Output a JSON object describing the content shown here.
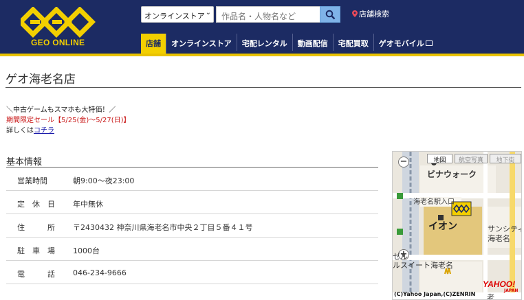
{
  "header": {
    "logo_text": "GEO ONLINE",
    "store_select": "オンラインストア",
    "search_placeholder": "作品名・人物名など",
    "store_search_label": "店舗検索"
  },
  "nav": {
    "items": [
      "店舗",
      "オンラインストア",
      "宅配レンタル",
      "動画配信",
      "宅配買取",
      "ゲオモバイル"
    ],
    "active_index": 0
  },
  "store": {
    "name": "ゲオ海老名店"
  },
  "promo": {
    "line1": "＼中古ゲームもスマホも大特価！／",
    "line2": "期間限定セール【5/25(金)～5/27(日)】",
    "line3_prefix": "詳しくは",
    "line3_link": "コチラ"
  },
  "basic_info": {
    "title": "基本情報",
    "rows": [
      {
        "label": "営業時間",
        "value": "朝9:00～夜23:00"
      },
      {
        "label": "定　休　日",
        "value": "年中無休"
      },
      {
        "label": "住　　　所",
        "value": "〒2430432 神奈川県海老名市中央２丁目５番４１号"
      },
      {
        "label": "駐　車　場",
        "value": "1000台"
      },
      {
        "label": "電　　　話",
        "value": "046-234-9666"
      }
    ]
  },
  "map": {
    "tabs": [
      "地図",
      "航空写真",
      "地下街"
    ],
    "labels": {
      "vinawalk": "ビナウォーク",
      "station": "海老名駅入口",
      "aeon": "イオン",
      "sanshiti": "サンシティ",
      "ebina": "海老名",
      "ru": "ルスイート海老名",
      "ebina2": "老",
      "ne": "ゼル"
    },
    "credit": "(C)Yahoo Japan,(C)ZENRIN",
    "yahoo_logo": "YAHOO!",
    "yahoo_sub": "JAPAN"
  },
  "colors": {
    "header_bg": "#1c2b63",
    "accent_yellow": "#f3cf00",
    "promo_red": "#c81414",
    "link_blue": "#1a1aaa"
  }
}
